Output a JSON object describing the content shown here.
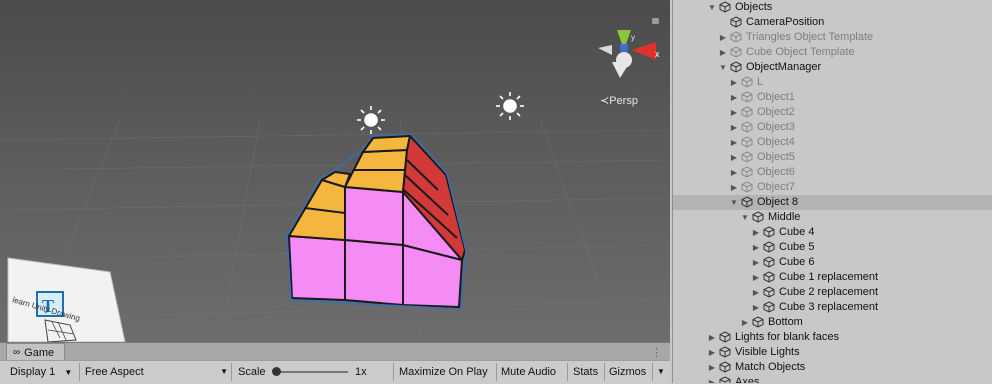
{
  "scene": {
    "persp_label": "≺Persp",
    "gizmo_axes": {
      "y": "y",
      "x": "x"
    },
    "book_text": "learn Unity Drawing",
    "colors": {
      "pink": "#f58cf5",
      "orange": "#f5b640",
      "red": "#d23a3a",
      "outline": "#3a6fb0"
    }
  },
  "game": {
    "tab_label": "Game",
    "toolbar": {
      "display": "Display 1",
      "aspect": "Free Aspect",
      "scale_label": "Scale",
      "scale_value": "1x",
      "maximize": "Maximize On Play",
      "mute": "Mute Audio",
      "stats": "Stats",
      "gizmos": "Gizmos"
    }
  },
  "hierarchy": {
    "items": [
      {
        "label": "Objects",
        "depth": 0,
        "arrow": "down",
        "dim": false
      },
      {
        "label": "CameraPosition",
        "depth": 1,
        "arrow": "none",
        "dim": false
      },
      {
        "label": "Triangles Object Template",
        "depth": 1,
        "arrow": "right",
        "dim": true
      },
      {
        "label": "Cube Object Template",
        "depth": 1,
        "arrow": "right",
        "dim": true
      },
      {
        "label": "ObjectManager",
        "depth": 1,
        "arrow": "down",
        "dim": false
      },
      {
        "label": "L",
        "depth": 2,
        "arrow": "right",
        "dim": true
      },
      {
        "label": "Object1",
        "depth": 2,
        "arrow": "right",
        "dim": true
      },
      {
        "label": "Object2",
        "depth": 2,
        "arrow": "right",
        "dim": true
      },
      {
        "label": "Object3",
        "depth": 2,
        "arrow": "right",
        "dim": true
      },
      {
        "label": "Object4",
        "depth": 2,
        "arrow": "right",
        "dim": true
      },
      {
        "label": "Object5",
        "depth": 2,
        "arrow": "right",
        "dim": true
      },
      {
        "label": "Object6",
        "depth": 2,
        "arrow": "right",
        "dim": true
      },
      {
        "label": "Object7",
        "depth": 2,
        "arrow": "right",
        "dim": true
      },
      {
        "label": "Object 8",
        "depth": 2,
        "arrow": "down",
        "dim": false,
        "selected": true
      },
      {
        "label": "Middle",
        "depth": 3,
        "arrow": "down",
        "dim": false
      },
      {
        "label": "Cube 4",
        "depth": 4,
        "arrow": "right",
        "dim": false
      },
      {
        "label": "Cube 5",
        "depth": 4,
        "arrow": "right",
        "dim": false
      },
      {
        "label": "Cube 6",
        "depth": 4,
        "arrow": "right",
        "dim": false
      },
      {
        "label": "Cube 1 replacement",
        "depth": 4,
        "arrow": "right",
        "dim": false
      },
      {
        "label": "Cube 2 replacement",
        "depth": 4,
        "arrow": "right",
        "dim": false
      },
      {
        "label": "Cube 3 replacement",
        "depth": 4,
        "arrow": "right",
        "dim": false
      },
      {
        "label": "Bottom",
        "depth": 3,
        "arrow": "right",
        "dim": false
      },
      {
        "label": "Lights for blank faces",
        "depth": 0,
        "arrow": "right",
        "dim": false
      },
      {
        "label": "Visible Lights",
        "depth": 0,
        "arrow": "right",
        "dim": false
      },
      {
        "label": "Match Objects",
        "depth": 0,
        "arrow": "right",
        "dim": false
      },
      {
        "label": "Axes",
        "depth": 0,
        "arrow": "right",
        "dim": false
      }
    ]
  }
}
